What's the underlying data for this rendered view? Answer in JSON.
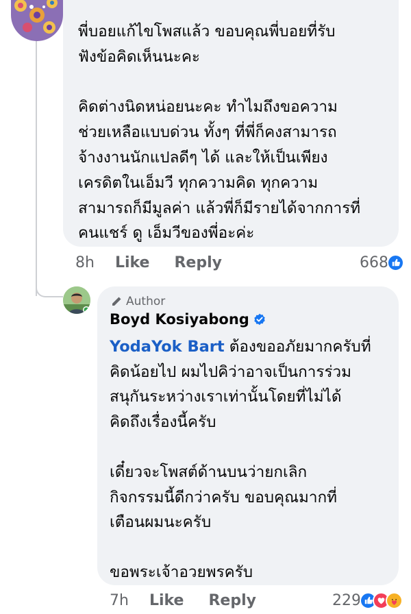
{
  "comment_1": {
    "text": "พี่บอยแก้ไขโพสแล้ว ขอบคุณพี่บอยที่รับ\nฟังข้อคิดเห็นนะคะ\n\nคิดต่างนิดหน่อยนะคะ ทำไมถึงขอความ\nช่วยเหลือแบบด่วน ทั้งๆ ที่พี่ก็คงสามารถ\nจ้างงานนักแปลดีๆ ได้ และให้เป็นเพียง\nเครดิตในเอ็มวี ทุกความคิด ทุกความ\nสามารถก็มีมูลค่า แล้วพี่ก็มีรายได้จากการที่\nคนแชร์ ดู เอ็มวีของพี่อะค่ะ",
    "time": "8h",
    "like_label": "Like",
    "reply_label": "Reply",
    "reaction_count": "668"
  },
  "reply_1": {
    "author_badge": "Author",
    "author_name": "Boyd Kosiyabong",
    "mention": "YodaYok Bart",
    "text": " ต้องขออภัยมากครับที่\nคิดน้อยไป ผมไปคิว่าอาจเป็นการร่วม\nสนุกันระหว่างเราเท่านั้นโดยที่ไม่ได้\nคิดถึงเรื่องนี้ครับ\n\nเดี๋ยวจะโพสต์ด้านบนว่ายกเลิก\nกิจกรรมนี้ดีกว่าครับ ขอบคุณมากที่\nเตือนผมนะครับ\n\nขอพระเจ้าอวยพรครับ",
    "time": "7h",
    "like_label": "Like",
    "reply_label": "Reply",
    "reaction_count": "229"
  },
  "colors": {
    "bubble": "#f0f2f5",
    "meta_text": "#65676b",
    "mention": "#1b5fc6",
    "like_blue": "#1877f2",
    "love_red": "#f33e58",
    "care_yellow": "#f7b125"
  },
  "icons": {
    "like_reaction": "thumbs-up-icon",
    "love_reaction": "heart-icon",
    "care_reaction": "care-emoji-icon",
    "author_badge": "pencil-icon",
    "verified": "verified-badge-icon"
  }
}
